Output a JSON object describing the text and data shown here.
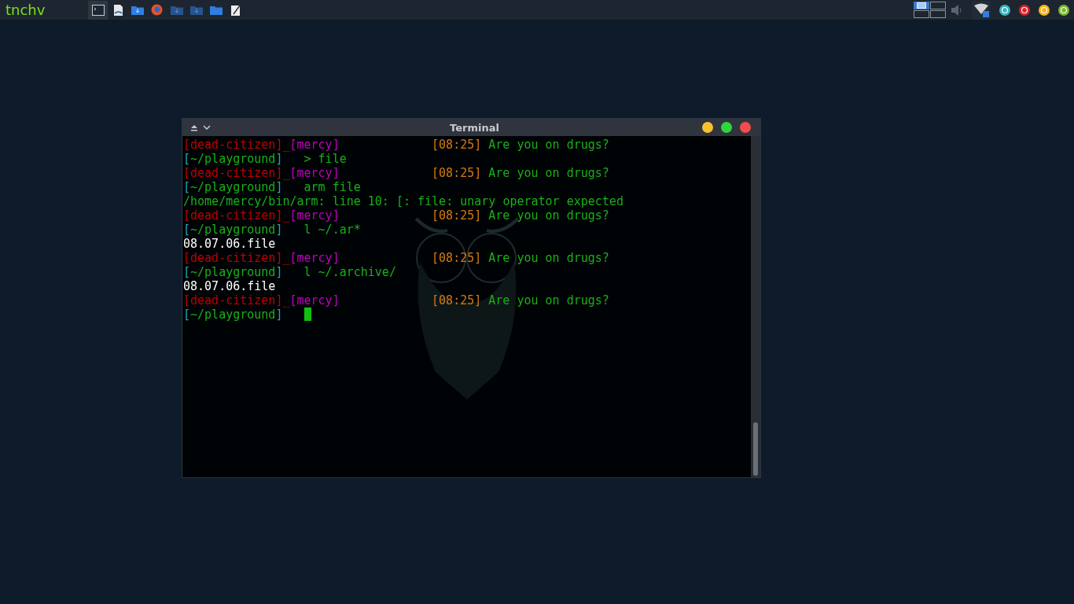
{
  "taskbar": {
    "logo": "tnchv",
    "launchers": [
      {
        "kind": "terminal",
        "selected": true
      },
      {
        "kind": "document",
        "selected": false
      },
      {
        "kind": "folder-download",
        "selected": false
      },
      {
        "kind": "browser",
        "selected": false
      },
      {
        "kind": "folder-dim",
        "selected": false
      },
      {
        "kind": "folder-dim",
        "selected": false
      },
      {
        "kind": "folder",
        "selected": false
      },
      {
        "kind": "notepad",
        "selected": false
      }
    ],
    "workspaces": [
      {
        "selected": true
      },
      {
        "selected": false
      },
      {
        "selected": false
      },
      {
        "selected": false
      }
    ],
    "tray": [
      {
        "kind": "volume"
      },
      {
        "kind": "wifi"
      },
      {
        "kind": "status",
        "color": "#3ab5c0"
      },
      {
        "kind": "status",
        "color": "#d8232a"
      },
      {
        "kind": "status",
        "color": "#f2b51b"
      },
      {
        "kind": "status",
        "color": "#7cb82f"
      }
    ]
  },
  "window": {
    "title": "Terminal",
    "lines": [
      {
        "kind": "prompt",
        "left": [
          {
            "text": "[dead-citizen]_",
            "color": "#c00000"
          },
          {
            "text": "[mercy]",
            "color": "#c000c0"
          }
        ],
        "right": [
          {
            "text": "[08:25]",
            "color": "#d47a10"
          },
          {
            "text": "Are you on drugs?",
            "color": "#18b018"
          }
        ]
      },
      {
        "kind": "command",
        "path": [
          {
            "text": "[",
            "color": "#19a9b9"
          },
          {
            "text": "~/playground",
            "color": "#18b018"
          },
          {
            "text": "]",
            "color": "#19a9b9"
          }
        ],
        "command": "> file",
        "cursor": false
      },
      {
        "kind": "prompt",
        "left": [
          {
            "text": "[dead-citizen]_",
            "color": "#c00000"
          },
          {
            "text": "[mercy]",
            "color": "#c000c0"
          }
        ],
        "right": [
          {
            "text": "[08:25]",
            "color": "#d47a10"
          },
          {
            "text": "Are you on drugs?",
            "color": "#18b018"
          }
        ]
      },
      {
        "kind": "command",
        "path": [
          {
            "text": "[",
            "color": "#19a9b9"
          },
          {
            "text": "~/playground",
            "color": "#18b018"
          },
          {
            "text": "]",
            "color": "#19a9b9"
          }
        ],
        "command": "arm file",
        "cursor": false
      },
      {
        "kind": "error",
        "text": "/home/mercy/bin/arm: line 10: [: file: unary operator expected"
      },
      {
        "kind": "prompt",
        "left": [
          {
            "text": "[dead-citizen]_",
            "color": "#c00000"
          },
          {
            "text": "[mercy]",
            "color": "#c000c0"
          }
        ],
        "right": [
          {
            "text": "[08:25]",
            "color": "#d47a10"
          },
          {
            "text": "Are you on drugs?",
            "color": "#18b018"
          }
        ]
      },
      {
        "kind": "command",
        "path": [
          {
            "text": "[",
            "color": "#19a9b9"
          },
          {
            "text": "~/playground",
            "color": "#18b018"
          },
          {
            "text": "]",
            "color": "#19a9b9"
          }
        ],
        "command": "l ~/.ar*",
        "cursor": false
      },
      {
        "kind": "output",
        "text": "08.07.06.file"
      },
      {
        "kind": "prompt",
        "left": [
          {
            "text": "[dead-citizen]_",
            "color": "#c00000"
          },
          {
            "text": "[mercy]",
            "color": "#c000c0"
          }
        ],
        "right": [
          {
            "text": "[08:25]",
            "color": "#d47a10"
          },
          {
            "text": "Are you on drugs?",
            "color": "#18b018"
          }
        ]
      },
      {
        "kind": "command",
        "path": [
          {
            "text": "[",
            "color": "#19a9b9"
          },
          {
            "text": "~/playground",
            "color": "#18b018"
          },
          {
            "text": "]",
            "color": "#19a9b9"
          }
        ],
        "command": "l ~/.archive/",
        "cursor": false
      },
      {
        "kind": "output",
        "text": "08.07.06.file"
      },
      {
        "kind": "prompt",
        "left": [
          {
            "text": "[dead-citizen]_",
            "color": "#c00000"
          },
          {
            "text": "[mercy]",
            "color": "#c000c0"
          }
        ],
        "right": [
          {
            "text": "[08:25]",
            "color": "#d47a10"
          },
          {
            "text": "Are you on drugs?",
            "color": "#18b018"
          }
        ]
      },
      {
        "kind": "command",
        "path": [
          {
            "text": "[",
            "color": "#19a9b9"
          },
          {
            "text": "~/playground",
            "color": "#18b018"
          },
          {
            "text": "]",
            "color": "#19a9b9"
          }
        ],
        "cursor": true
      }
    ]
  }
}
